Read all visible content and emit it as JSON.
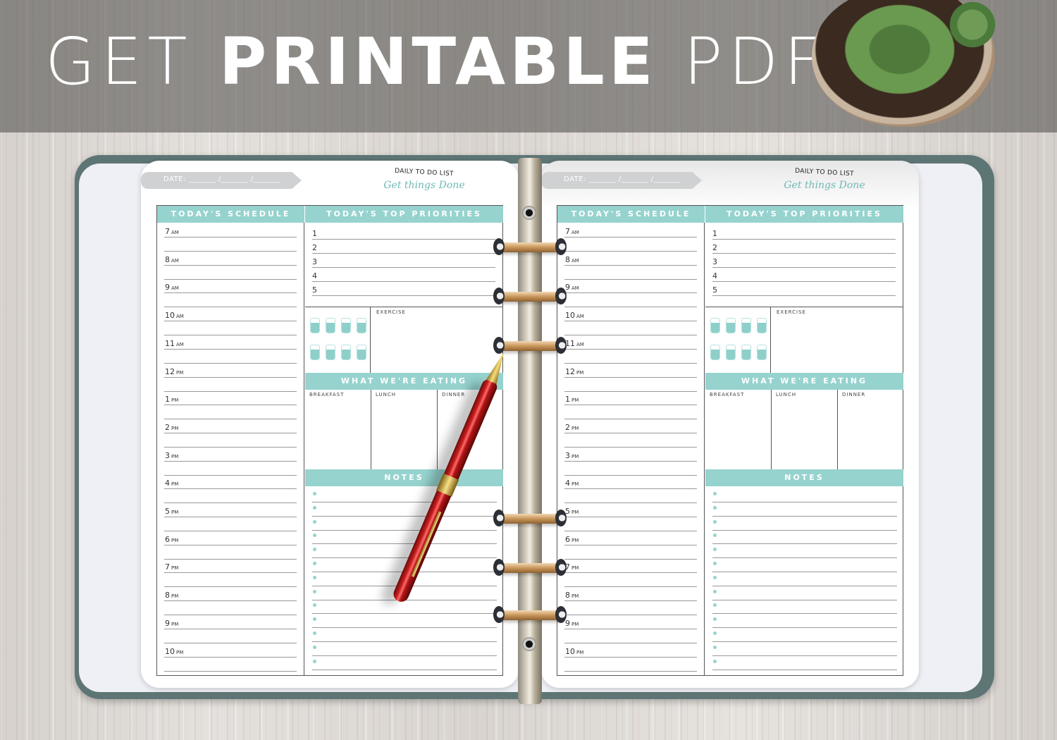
{
  "banner": {
    "word1": "GET",
    "word2": "PRINTABLE",
    "word3": "PDF"
  },
  "planner": {
    "date_label": "DATE: _______ /_______ /_______",
    "subtitle_small": "DAILY TO DO LIST",
    "subtitle_script": "Get things Done",
    "schedule_header": "TODAY'S SCHEDULE",
    "priorities_header": "TODAY'S TOP PRIORITIES",
    "hours": [
      {
        "h": "7",
        "p": "AM"
      },
      {
        "h": "8",
        "p": "AM"
      },
      {
        "h": "9",
        "p": "AM"
      },
      {
        "h": "10",
        "p": "AM"
      },
      {
        "h": "11",
        "p": "AM"
      },
      {
        "h": "12",
        "p": "PM"
      },
      {
        "h": "1",
        "p": "PM"
      },
      {
        "h": "2",
        "p": "PM"
      },
      {
        "h": "3",
        "p": "PM"
      },
      {
        "h": "4",
        "p": "PM"
      },
      {
        "h": "5",
        "p": "PM"
      },
      {
        "h": "6",
        "p": "PM"
      },
      {
        "h": "7",
        "p": "PM"
      },
      {
        "h": "8",
        "p": "PM"
      },
      {
        "h": "9",
        "p": "PM"
      },
      {
        "h": "10",
        "p": "PM"
      }
    ],
    "priorities": [
      "1",
      "2",
      "3",
      "4",
      "5"
    ],
    "water_glasses": 8,
    "exercise_label": "EXERCISE",
    "eating_header": "WHAT WE'RE EATING",
    "meals": [
      "BREAKFAST",
      "LUNCH",
      "DINNER"
    ],
    "notes_header": "NOTES",
    "notes_lines": 13,
    "accent_color": "#96d3cf",
    "date_bar_color": "#d0d1d3"
  }
}
